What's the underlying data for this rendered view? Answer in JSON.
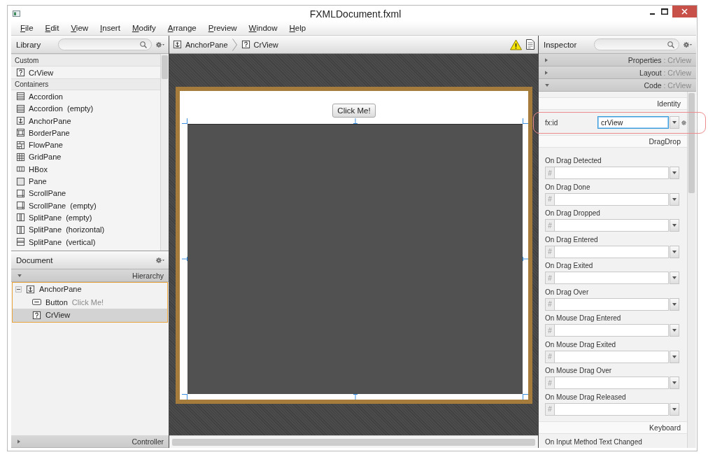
{
  "window": {
    "title": "FXMLDocument.fxml"
  },
  "menu": [
    {
      "label": "File"
    },
    {
      "label": "Edit"
    },
    {
      "label": "View"
    },
    {
      "label": "Insert"
    },
    {
      "label": "Modify"
    },
    {
      "label": "Arrange"
    },
    {
      "label": "Preview"
    },
    {
      "label": "Window"
    },
    {
      "label": "Help"
    }
  ],
  "library": {
    "title": "Library",
    "sections": [
      {
        "title": "Custom",
        "items": [
          {
            "label": "CrView",
            "kind": "custom"
          }
        ]
      },
      {
        "title": "Containers",
        "items": [
          {
            "label": "Accordion",
            "kind": "accordion"
          },
          {
            "label": "Accordion",
            "note": "(empty)",
            "kind": "accordion"
          },
          {
            "label": "AnchorPane",
            "kind": "anchor"
          },
          {
            "label": "BorderPane",
            "kind": "border"
          },
          {
            "label": "FlowPane",
            "kind": "flow"
          },
          {
            "label": "GridPane",
            "kind": "grid"
          },
          {
            "label": "HBox",
            "kind": "hbox"
          },
          {
            "label": "Pane",
            "kind": "pane"
          },
          {
            "label": "ScrollPane",
            "kind": "scroll"
          },
          {
            "label": "ScrollPane",
            "note": "(empty)",
            "kind": "scroll"
          },
          {
            "label": "SplitPane",
            "note": "(empty)",
            "kind": "hsplit"
          },
          {
            "label": "SplitPane",
            "note": "(horizontal)",
            "kind": "hsplit"
          },
          {
            "label": "SplitPane",
            "note": "(vertical)",
            "kind": "vsplit"
          }
        ]
      }
    ]
  },
  "document": {
    "title": "Document",
    "hierarchy": {
      "label": "Hierarchy",
      "expanded": true
    },
    "tree": [
      {
        "label": "AnchorPane",
        "kind": "anchor",
        "expanded": true,
        "highlighted": true,
        "selected": false,
        "children": [
          {
            "label": "Button",
            "detail": "Click Me!",
            "kind": "button",
            "selected": false
          },
          {
            "label": "CrView",
            "kind": "custom",
            "selected": true
          }
        ]
      }
    ],
    "controller": {
      "label": "Controller",
      "expanded": false
    }
  },
  "breadcrumb": [
    {
      "label": "AnchorPane",
      "kind": "anchor"
    },
    {
      "label": "CrView",
      "kind": "custom"
    }
  ],
  "canvas": {
    "frame_highlighted": true,
    "button": {
      "label": "Click Me!"
    },
    "custom_view": {
      "selected": true
    }
  },
  "inspector": {
    "title": "Inspector",
    "sections": [
      {
        "title": "Properties",
        "subtitle": ": CrView",
        "expanded": false
      },
      {
        "title": "Layout",
        "subtitle": ": CrView",
        "expanded": false
      },
      {
        "title": "Code",
        "subtitle": ": CrView",
        "expanded": true
      }
    ],
    "identity": {
      "header": "Identity",
      "label": "fx:id",
      "value": "crView",
      "focused": true,
      "highlighted": true
    },
    "groups": [
      {
        "header": "DragDrop",
        "events": [
          {
            "label": "On Drag Detected",
            "prefix": "#"
          },
          {
            "label": "On Drag Done",
            "prefix": "#"
          },
          {
            "label": "On Drag Dropped",
            "prefix": "#"
          },
          {
            "label": "On Drag Entered",
            "prefix": "#"
          },
          {
            "label": "On Drag Exited",
            "prefix": "#"
          },
          {
            "label": "On Drag Over",
            "prefix": "#"
          },
          {
            "label": "On Mouse Drag Entered",
            "prefix": "#"
          },
          {
            "label": "On Mouse Drag Exited",
            "prefix": "#"
          },
          {
            "label": "On Mouse Drag Over",
            "prefix": "#"
          },
          {
            "label": "On Mouse Drag Released",
            "prefix": "#"
          }
        ]
      },
      {
        "header": "Keyboard",
        "events": [
          {
            "label": "On Input Method Text Changed"
          }
        ]
      }
    ]
  }
}
